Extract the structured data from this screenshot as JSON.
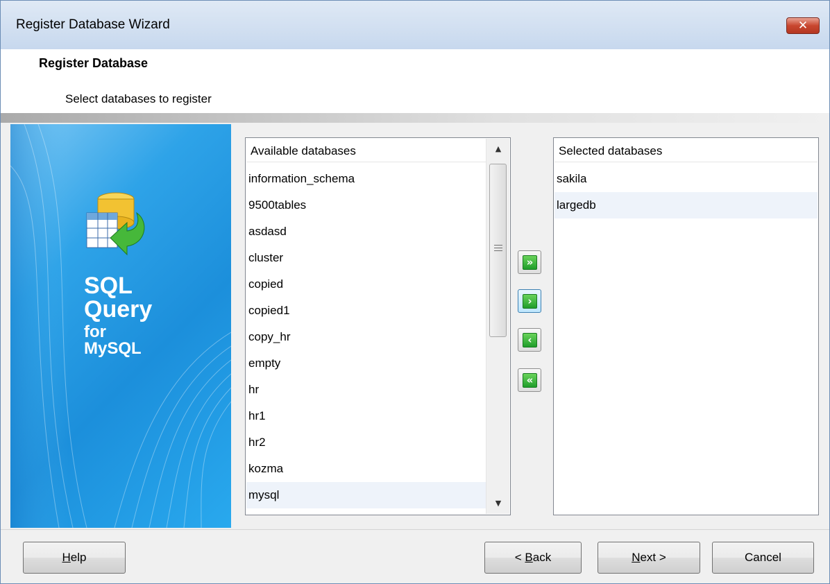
{
  "window": {
    "title": "Register Database Wizard",
    "close_glyph": "✕"
  },
  "header": {
    "title": "Register Database",
    "subtitle": "Select databases to register"
  },
  "sidebar": {
    "brand": [
      "SQL",
      "Query",
      "for",
      "MySQL"
    ],
    "icon": "database-import-icon"
  },
  "available": {
    "header": "Available databases",
    "items": [
      "information_schema",
      "9500tables",
      "asdasd",
      "cluster",
      "copied",
      "copied1",
      "copy_hr",
      "empty",
      "hr",
      "hr1",
      "hr2",
      "kozma",
      "mysql"
    ]
  },
  "selected": {
    "header": "Selected databases",
    "items": [
      "sakila",
      "largedb"
    ]
  },
  "move_buttons": {
    "add_all": "»",
    "add": "›",
    "remove": "‹",
    "remove_all": "«"
  },
  "scrollbar": {
    "up": "▲",
    "down": "▼"
  },
  "footer": {
    "help": {
      "mnemonic": "H",
      "rest": "elp"
    },
    "back": {
      "prefix": "< ",
      "mnemonic": "B",
      "rest": "ack"
    },
    "next": {
      "mnemonic": "N",
      "rest": "ext >"
    },
    "cancel": "Cancel"
  },
  "colors": {
    "accent": "#1c8fdb",
    "move_green": "#1f9d2a"
  }
}
